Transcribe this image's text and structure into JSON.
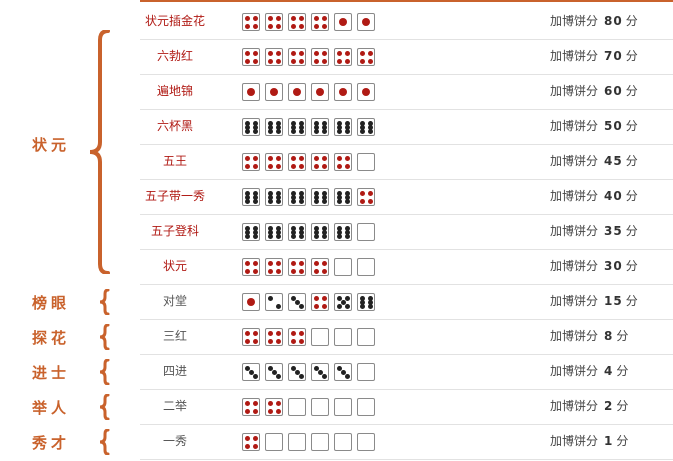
{
  "colors": {
    "red_pip": "#b01a14",
    "black_pip": "#222222",
    "accent": "#c9622c"
  },
  "categories": [
    {
      "label": "状元",
      "rows": [
        0,
        7
      ]
    },
    {
      "label": "榜眼",
      "rows": [
        8,
        8
      ]
    },
    {
      "label": "探花",
      "rows": [
        9,
        9
      ]
    },
    {
      "label": "进士",
      "rows": [
        10,
        10
      ]
    },
    {
      "label": "举人",
      "rows": [
        11,
        11
      ]
    },
    {
      "label": "秀才",
      "rows": [
        12,
        12
      ]
    }
  ],
  "rows": [
    {
      "name": "状元插金花",
      "red": true,
      "dice": [
        4,
        4,
        4,
        4,
        1,
        1
      ],
      "prefix": "加博饼分",
      "score": "80",
      "unit": "分"
    },
    {
      "name": "六勃红",
      "red": true,
      "dice": [
        4,
        4,
        4,
        4,
        4,
        4
      ],
      "prefix": "加博饼分",
      "score": "70",
      "unit": "分"
    },
    {
      "name": "遍地锦",
      "red": true,
      "dice": [
        1,
        1,
        1,
        1,
        1,
        1
      ],
      "prefix": "加博饼分",
      "score": "60",
      "unit": "分"
    },
    {
      "name": "六杯黑",
      "red": true,
      "dice": [
        6,
        6,
        6,
        6,
        6,
        6
      ],
      "prefix": "加博饼分",
      "score": "50",
      "unit": "分"
    },
    {
      "name": "五王",
      "red": true,
      "dice": [
        4,
        4,
        4,
        4,
        4,
        0
      ],
      "prefix": "加博饼分",
      "score": "45",
      "unit": "分"
    },
    {
      "name": "五子带一秀",
      "red": true,
      "dice": [
        6,
        6,
        6,
        6,
        6,
        4
      ],
      "prefix": "加博饼分",
      "score": "40",
      "unit": "分"
    },
    {
      "name": "五子登科",
      "red": true,
      "dice": [
        6,
        6,
        6,
        6,
        6,
        0
      ],
      "prefix": "加博饼分",
      "score": "35",
      "unit": "分"
    },
    {
      "name": "状元",
      "red": true,
      "dice": [
        4,
        4,
        4,
        4,
        0,
        0
      ],
      "prefix": "加博饼分",
      "score": "30",
      "unit": "分"
    },
    {
      "name": "对堂",
      "red": false,
      "dice": [
        1,
        2,
        3,
        4,
        5,
        6
      ],
      "prefix": "加博饼分",
      "score": "15",
      "unit": "分"
    },
    {
      "name": "三红",
      "red": false,
      "dice": [
        4,
        4,
        4,
        0,
        0,
        0
      ],
      "prefix": "加博饼分",
      "score": "8",
      "unit": "分"
    },
    {
      "name": "四进",
      "red": false,
      "dice": [
        3,
        3,
        3,
        3,
        3,
        0
      ],
      "prefix": "加博饼分",
      "score": "4",
      "unit": "分"
    },
    {
      "name": "二举",
      "red": false,
      "dice": [
        4,
        4,
        0,
        0,
        0,
        0
      ],
      "prefix": "加博饼分",
      "score": "2",
      "unit": "分"
    },
    {
      "name": "一秀",
      "red": false,
      "dice": [
        4,
        0,
        0,
        0,
        0,
        0
      ],
      "prefix": "加博饼分",
      "score": "1",
      "unit": "分"
    }
  ]
}
